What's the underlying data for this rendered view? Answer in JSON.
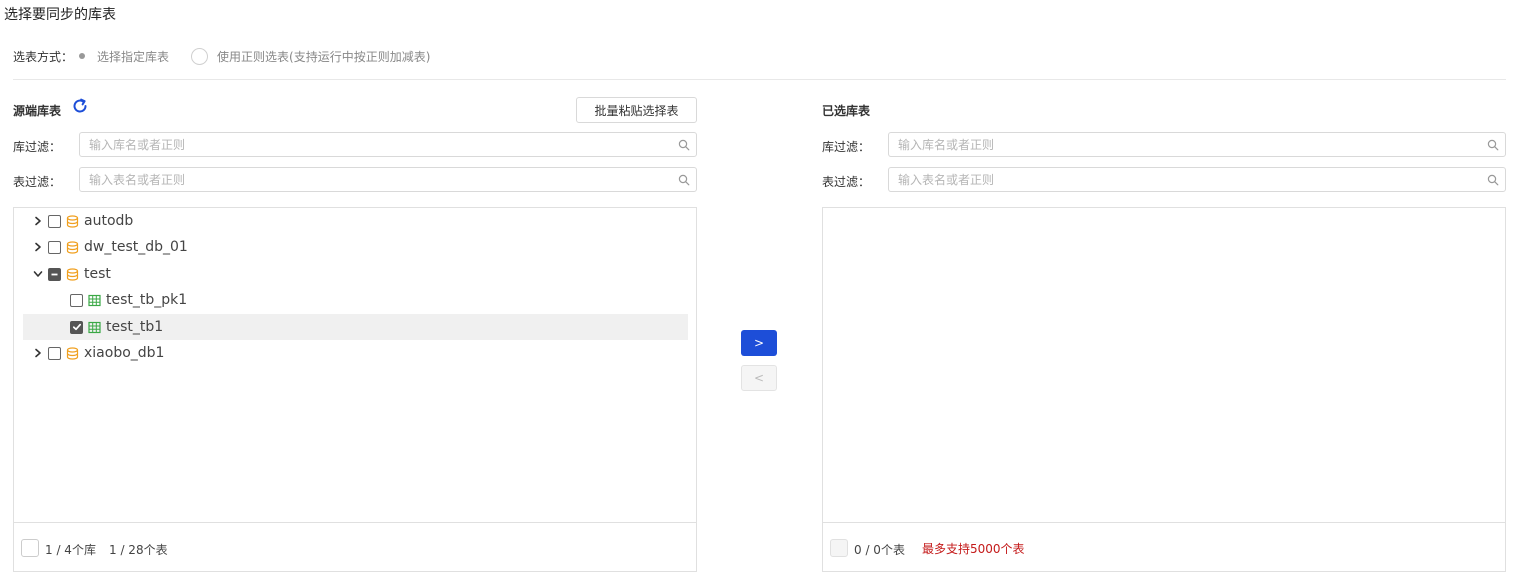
{
  "page": {
    "title": "选择要同步的库表"
  },
  "mode": {
    "label": "选表方式：",
    "options": [
      {
        "label": "选择指定库表",
        "selected": true
      },
      {
        "label": "使用正则选表(支持运行中按正则加减表)",
        "selected": false
      }
    ]
  },
  "source": {
    "title": "源端库表",
    "paste_button": "批量粘贴选择表",
    "db_filter": {
      "label": "库过滤：",
      "placeholder": "输入库名或者正则",
      "value": ""
    },
    "table_filter": {
      "label": "表过滤：",
      "placeholder": "输入表名或者正则",
      "value": ""
    },
    "tree": [
      {
        "label": "autodb",
        "type": "database",
        "expanded": false,
        "checked": "none"
      },
      {
        "label": "dw_test_db_01",
        "type": "database",
        "expanded": false,
        "checked": "none"
      },
      {
        "label": "test",
        "type": "database",
        "expanded": true,
        "checked": "partial"
      },
      {
        "label": "test_tb_pk1",
        "type": "table",
        "checked": "none"
      },
      {
        "label": "test_tb1",
        "type": "table",
        "checked": "checked",
        "highlighted": true
      },
      {
        "label": "xiaobo_db1",
        "type": "database",
        "expanded": false,
        "checked": "none"
      }
    ],
    "footer": {
      "db_count": "1 / 4个库",
      "table_count": "1 / 28个表"
    }
  },
  "transfer": {
    "to_right": ">",
    "to_left": "<"
  },
  "selected": {
    "title": "已选库表",
    "db_filter": {
      "label": "库过滤：",
      "placeholder": "输入库名或者正则",
      "value": ""
    },
    "table_filter": {
      "label": "表过滤：",
      "placeholder": "输入表名或者正则",
      "value": ""
    },
    "footer": {
      "table_count": "0 / 0个表",
      "limit_note": "最多支持5000个表"
    }
  },
  "colors": {
    "primary": "#1d4ed8",
    "db_icon": "#f0a020",
    "table_icon": "#3aa845",
    "warning": "#c41a1a"
  }
}
